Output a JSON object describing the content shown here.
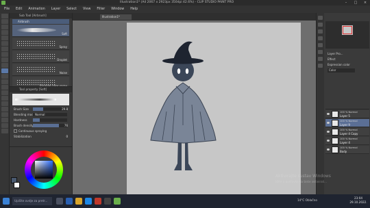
{
  "window": {
    "title": "Illustration1* (A4 2067 x 2923px 350dpi 42.6%)  - CLIP STUDIO PAINT PRO",
    "controls": [
      "–",
      "□",
      "×"
    ]
  },
  "menu": [
    "File",
    "Edit",
    "Animation",
    "Layer",
    "Select",
    "View",
    "Filter",
    "Window",
    "Help"
  ],
  "subtool": {
    "header": "Sub Tool [Airbrush]",
    "group_tab": "Airbrush",
    "brushes": [
      {
        "name": "Soft",
        "selected": true
      },
      {
        "name": "Spray",
        "selected": false
      },
      {
        "name": "Droplet",
        "selected": false
      },
      {
        "name": "Noise",
        "selected": false
      },
      {
        "name": "Running color spray",
        "selected": false
      }
    ]
  },
  "tool_property": {
    "header": "Tool property [Soft]",
    "brush_size": {
      "label": "Brush Size",
      "value": "29.8",
      "fill": 0.3
    },
    "blending_mode": {
      "label": "Blending mode",
      "value": "Normal"
    },
    "hardness": {
      "label": "Hardness",
      "fill": 0.2
    },
    "brush_density": {
      "label": "Brush density",
      "value": "76",
      "fill": 0.76
    },
    "continuous_spraying": {
      "label": "Continuous spraying",
      "checked": false
    },
    "stabilization": {
      "label": "Stabilization",
      "value": "0"
    }
  },
  "document_tab": "Illustration1*",
  "layer_property": {
    "header": "Layer Pro...",
    "effect_label": "Effect",
    "expression_label": "Expression color",
    "expression_value": "Color"
  },
  "layers": [
    {
      "mode": "100 % Normal",
      "name": "Layer 5",
      "active": false
    },
    {
      "mode": "100 % Normal",
      "name": "Layer 9",
      "active": true
    },
    {
      "mode": "100 % Normal",
      "name": "Layer 4 Copy",
      "active": false
    },
    {
      "mode": "100 % Normal",
      "name": "Layer 4",
      "active": false
    },
    {
      "mode": "100 % Normal",
      "name": "Body",
      "active": false
    }
  ],
  "activation": {
    "line1": "Aktivirajte sustav Windows",
    "line2": "Idite u postavke da biste aktivirali..."
  },
  "taskbar": {
    "search_placeholder": "Upišite ovdje za pretr...",
    "weather": "14°C  Oblačno",
    "time": "23:04",
    "date": "29.10.2022."
  },
  "colors": {
    "accent": "#5b79a8",
    "paper": "#c7c7c7",
    "character": "#3b4658",
    "cloak": "#7a8597"
  }
}
